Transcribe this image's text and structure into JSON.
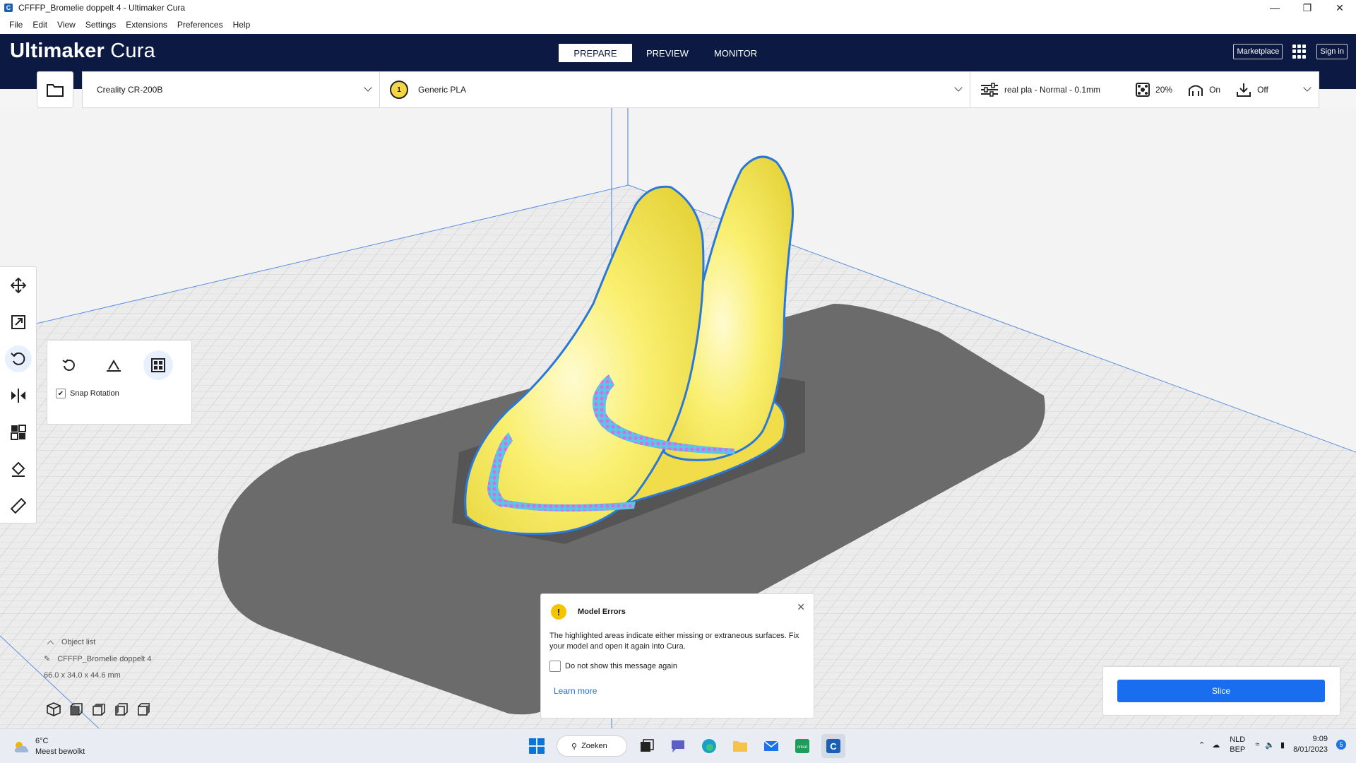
{
  "window": {
    "title": "CFFFP_Bromelie doppelt 4 - Ultimaker Cura"
  },
  "menu": [
    "File",
    "Edit",
    "View",
    "Settings",
    "Extensions",
    "Preferences",
    "Help"
  ],
  "header": {
    "logo_bold": "Ultimaker",
    "logo_light": "Cura",
    "tabs": [
      {
        "label": "PREPARE",
        "active": true
      },
      {
        "label": "PREVIEW",
        "active": false
      },
      {
        "label": "MONITOR",
        "active": false
      }
    ],
    "marketplace": "Marketplace",
    "sign_in": "Sign in"
  },
  "toolbar": {
    "printer": "Creality CR-200B",
    "material_index": "1",
    "material": "Generic PLA",
    "profile": "real pla - Normal - 0.1mm",
    "infill": "20%",
    "support": "On",
    "adhesion": "Off"
  },
  "rotate_panel": {
    "snap_label": "Snap Rotation",
    "snap_checked": true
  },
  "object_list": {
    "header": "Object list",
    "item": "CFFFP_Bromelie doppelt 4",
    "dimensions": "66.0 x 34.0 x 44.6 mm"
  },
  "dialog": {
    "title": "Model Errors",
    "body": "The highlighted areas indicate either missing or extraneous surfaces. Fix your model and open it again into Cura.",
    "checkbox": "Do not show this message again",
    "link": "Learn more"
  },
  "slice": {
    "button": "Slice"
  },
  "taskbar": {
    "temp": "6°C",
    "weather": "Meest bewolkt",
    "search": "Zoeken",
    "lang_top": "NLD",
    "lang_bottom": "BEP",
    "time": "9:09",
    "date": "8/01/2023",
    "notifications": "5"
  },
  "colors": {
    "header_bg": "#0c1a43",
    "accent": "#196ef0",
    "model": "#f7ec6a",
    "model_outline": "#2a78d8",
    "error_highlight": "#b36ce0"
  }
}
